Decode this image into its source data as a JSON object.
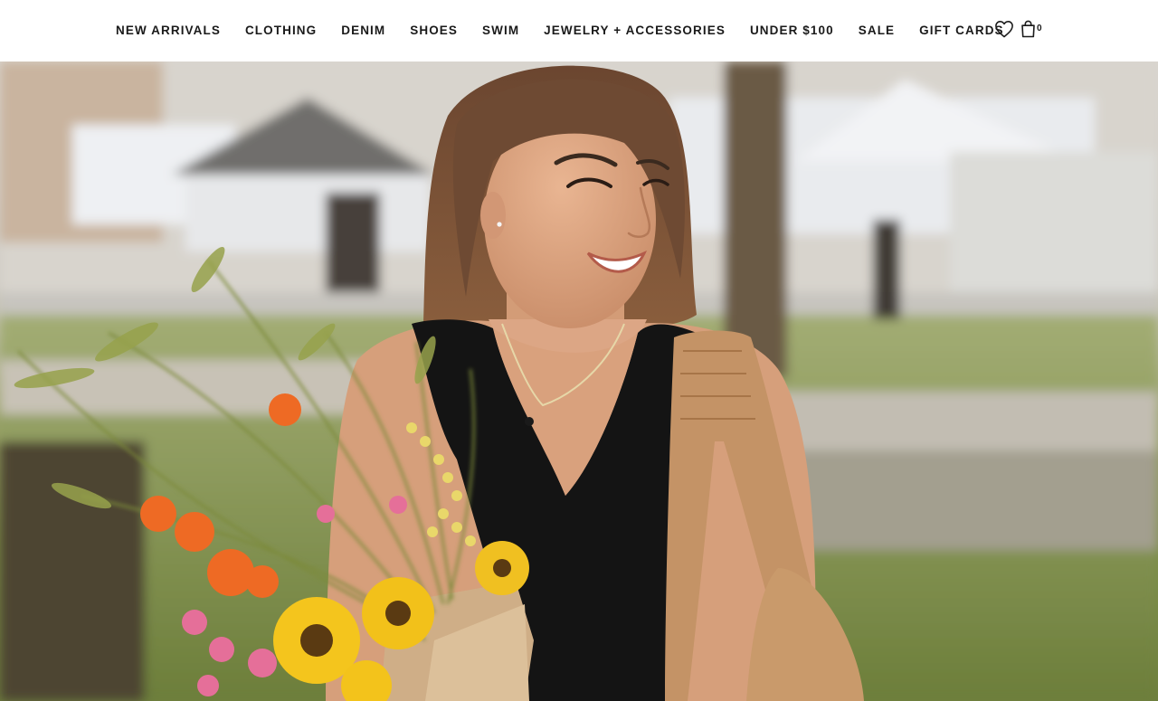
{
  "nav": {
    "items": [
      {
        "label": "NEW ARRIVALS"
      },
      {
        "label": "CLOTHING"
      },
      {
        "label": "DENIM"
      },
      {
        "label": "SHOES"
      },
      {
        "label": "SWIM"
      },
      {
        "label": "JEWELRY + ACCESSORIES"
      },
      {
        "label": "UNDER $100"
      },
      {
        "label": "SALE"
      },
      {
        "label": "GIFT CARDS"
      }
    ]
  },
  "header": {
    "wishlist_icon": "heart-icon",
    "bag_icon": "shopping-bag-icon",
    "bag_count": "0"
  },
  "hero": {
    "image": "woman-holding-flower-bouquet-photo"
  },
  "colors": {
    "nav_text": "#1a1a1a",
    "header_bg": "#ffffff"
  }
}
